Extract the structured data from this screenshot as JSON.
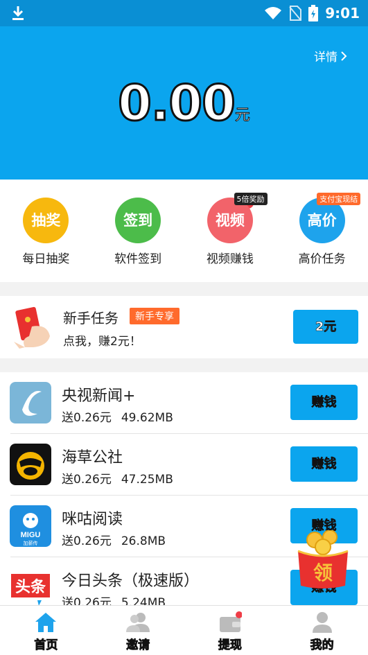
{
  "status_bar": {
    "time": "9:01"
  },
  "hero": {
    "detail_label": "详情",
    "balance": "0.00",
    "unit": "元"
  },
  "quick_actions": [
    {
      "circle_text": "抽奖",
      "label": "每日抽奖",
      "color": "#f7b80e",
      "badge": ""
    },
    {
      "circle_text": "签到",
      "label": "软件签到",
      "color": "#4cbc4a",
      "badge": ""
    },
    {
      "circle_text": "视频",
      "label": "视频赚钱",
      "color": "#f2636a",
      "badge": "5倍奖励"
    },
    {
      "circle_text": "高价",
      "label": "高价任务",
      "color": "#1ea3ec",
      "badge": "支付宝现结"
    }
  ],
  "newbie": {
    "title": "新手任务",
    "tag": "新手专享",
    "subtitle": "点我，赚2元！",
    "button": "2元"
  },
  "apps": [
    {
      "name": "央视新闻+",
      "reward": "送0.26元",
      "size": "49.62MB",
      "button": "赚钱",
      "icon": "cctv-news-icon"
    },
    {
      "name": "海草公社",
      "reward": "送0.26元",
      "size": "47.25MB",
      "button": "赚钱",
      "icon": "haicao-icon"
    },
    {
      "name": "咪咕阅读",
      "reward": "送0.26元",
      "size": "26.8MB",
      "button": "赚钱",
      "icon": "migu-icon",
      "icon_text": "MIGU",
      "icon_sub": "加薪传"
    },
    {
      "name": "今日头条（极速版）",
      "reward": "送0.26元",
      "size": "5.24MB",
      "button": "赚钱",
      "icon": "toutiao-icon",
      "icon_text": "头条"
    }
  ],
  "float_badge": "领",
  "tabs": [
    {
      "label": "首页",
      "icon": "home-icon",
      "active": true
    },
    {
      "label": "邀请",
      "icon": "invite-icon",
      "active": false
    },
    {
      "label": "提现",
      "icon": "wallet-icon",
      "active": false
    },
    {
      "label": "我的",
      "icon": "profile-icon",
      "active": false
    }
  ]
}
